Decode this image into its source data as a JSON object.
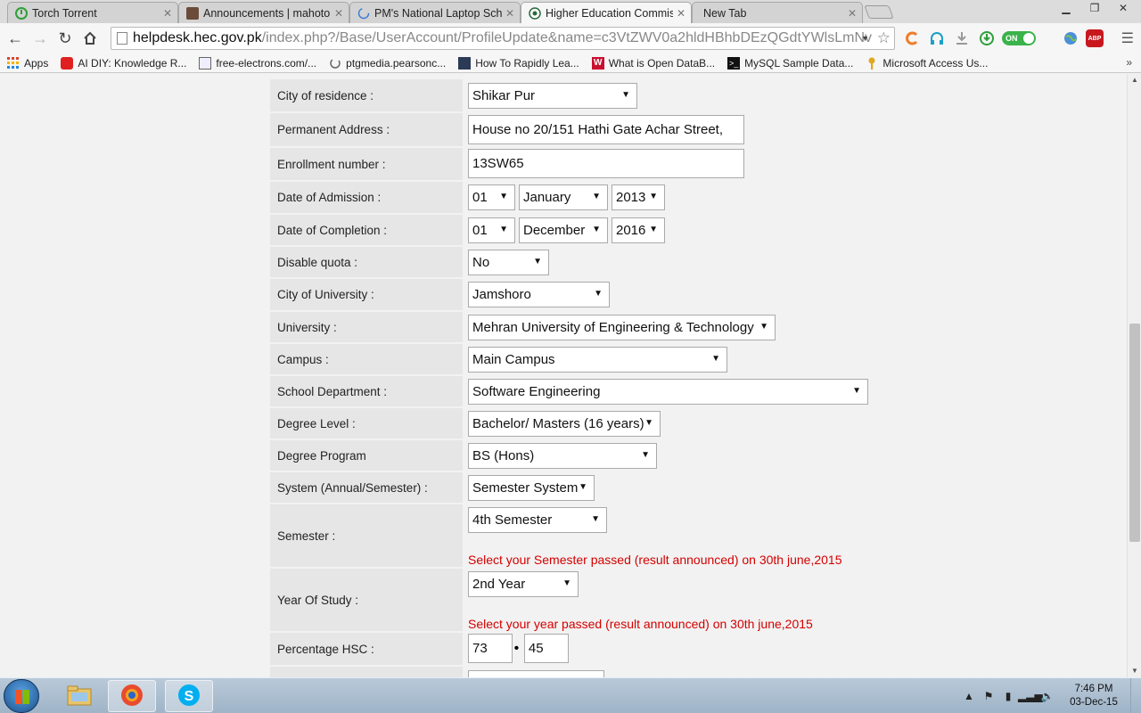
{
  "browser": {
    "tabs": [
      {
        "title": "Torch Torrent",
        "icon": "torch-icon",
        "active": false
      },
      {
        "title": "Announcements | mahoto",
        "icon": "avatar-icon",
        "active": false
      },
      {
        "title": "PM's National Laptop Sch",
        "icon": "loading-icon",
        "active": false
      },
      {
        "title": "Higher Education Commis",
        "icon": "hec-icon",
        "active": true
      },
      {
        "title": "New Tab",
        "icon": "",
        "active": false
      }
    ],
    "url_host": "helpdesk.hec.gov.pk",
    "url_path": "/index.php?/Base/UserAccount/ProfileUpdate&name=c3VtZWV0a2hldHBhbDEzQGdtYWlsLmNv",
    "toggle_label": "ON",
    "abp_label": "ABP",
    "bookmarks": [
      {
        "label": "Apps",
        "icon": "apps-grid-icon"
      },
      {
        "label": "AI DIY: Knowledge R...",
        "icon": "youtube-icon"
      },
      {
        "label": "free-electrons.com/...",
        "icon": "page-icon"
      },
      {
        "label": "ptgmedia.pearsonc...",
        "icon": "loading-icon"
      },
      {
        "label": "How To Rapidly Lea...",
        "icon": "site-icon"
      },
      {
        "label": "What is Open DataB...",
        "icon": "w-icon"
      },
      {
        "label": "MySQL Sample Data...",
        "icon": "terminal-icon"
      },
      {
        "label": "Microsoft Access Us...",
        "icon": "key-icon"
      }
    ]
  },
  "form": {
    "city_residence": {
      "label": "City of residence :",
      "value": "Shikar Pur"
    },
    "permanent_address": {
      "label": "Permanent Address :",
      "value": "House no 20/151 Hathi Gate Achar Street,"
    },
    "enrollment": {
      "label": "Enrollment number :",
      "value": "13SW65"
    },
    "admission": {
      "label": "Date of Admission :",
      "day": "01",
      "month": "January",
      "year": "2013"
    },
    "completion": {
      "label": "Date of Completion :",
      "day": "01",
      "month": "December",
      "year": "2016"
    },
    "disable_quota": {
      "label": "Disable quota :",
      "value": "No"
    },
    "city_university": {
      "label": "City of University :",
      "value": "Jamshoro"
    },
    "university": {
      "label": "University :",
      "value": "Mehran University of Engineering & Technology"
    },
    "campus": {
      "label": "Campus :",
      "value": "Main Campus"
    },
    "department": {
      "label": "School Department :",
      "value": "Software Engineering"
    },
    "degree_level": {
      "label": "Degree Level :",
      "value": "Bachelor/ Masters (16 years)"
    },
    "degree_program": {
      "label": "Degree Program",
      "value": "BS (Hons)"
    },
    "system": {
      "label": "System (Annual/Semester) :",
      "value": "Semester System"
    },
    "semester": {
      "label": "Semester :",
      "value": "4th Semester",
      "hint": "Select your Semester passed (result announced) on 30th june,2015"
    },
    "year_of_study": {
      "label": "Year Of Study :",
      "value": "2nd Year",
      "hint": "Select your year passed (result announced) on 30th june,2015"
    },
    "percentage_hsc": {
      "label": "Percentage HSC :",
      "whole": "73",
      "fraction": "45"
    }
  },
  "taskbar": {
    "time": "7:46 PM",
    "date": "03-Dec-15"
  }
}
